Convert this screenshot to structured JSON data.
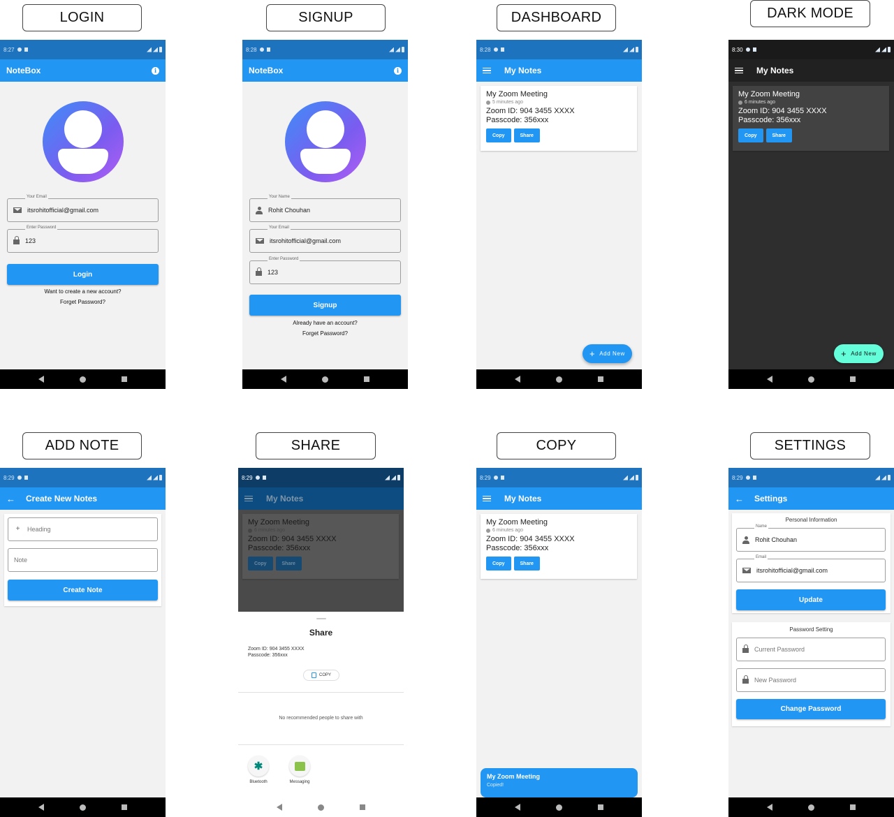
{
  "labels": {
    "login": "LOGIN",
    "signup": "SIGNUP",
    "dashboard": "DASHBOARD",
    "dark_mode": "DARK MODE",
    "add_note": "ADD NOTE",
    "share": "SHARE",
    "copy": "COPY",
    "settings": "SETTINGS"
  },
  "times": {
    "login": "8:27",
    "signup": "8:28",
    "dashboard": "8:28",
    "dark": "8:30",
    "add_note": "8:29",
    "share": "8:29",
    "copy": "8:29",
    "settings": "8:29"
  },
  "app_name": "NoteBox",
  "login": {
    "email_label": "Your Email",
    "email_value": "itsrohitofficial@gmail.com",
    "password_label": "Enter Password",
    "password_value": "123",
    "login_button": "Login",
    "create_account_link": "Want to create a new account?",
    "forget_password_link": "Forget Password?"
  },
  "signup": {
    "name_label": "Your Name",
    "name_value": "Rohit Chouhan",
    "email_label": "Your Email",
    "email_value": "itsrohitofficial@gmail.com",
    "password_label": "Enter Password",
    "password_value": "123",
    "signup_button": "Signup",
    "have_account_link": "Already have an account?",
    "forget_password_link": "Forget Password?"
  },
  "dashboard": {
    "title": "My Notes",
    "add_new": "Add New"
  },
  "note": {
    "title": "My Zoom Meeting",
    "time_ago": "5 minutes ago",
    "time_ago_later": "6 minutes ago",
    "line1": "Zoom ID: 904 3455 XXXX",
    "line2": "Passcode: 356xxx",
    "copy_button": "Copy",
    "share_button": "Share"
  },
  "add_note": {
    "title": "Create New Notes",
    "heading_placeholder": "Heading",
    "note_placeholder": "Note",
    "create_button": "Create Note"
  },
  "share": {
    "sheet_title": "Share",
    "line1": "Zoom ID: 904 3455 XXXX",
    "line2": "Passcode: 356xxx",
    "copy_chip": "COPY",
    "no_recommended": "No recommended people to share with",
    "apps": [
      "Bluetooth",
      "Messaging"
    ]
  },
  "copy": {
    "snack_title": "My Zoom Meeting",
    "snack_text": "Copied!"
  },
  "settings": {
    "title": "Settings",
    "personal_section": "Personal Information",
    "name_label": "Name",
    "name_value": "Rohit Chouhan",
    "email_label": "Email",
    "email_value": "itsrohitofficial@gmail.com",
    "update_button": "Update",
    "password_section": "Password Setting",
    "current_password_placeholder": "Current Password",
    "new_password_placeholder": "New Password",
    "change_password_button": "Change Password"
  },
  "colors": {
    "primary": "#2196f3",
    "status_bar": "#1e73bf",
    "dark_bg": "#2e2e2e",
    "dark_card": "#424242",
    "mint_fab": "#64ffda"
  }
}
